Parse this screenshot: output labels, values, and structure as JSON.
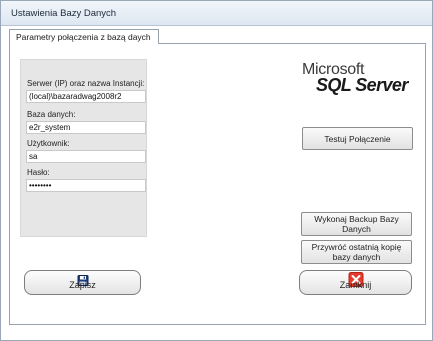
{
  "window": {
    "title": "Ustawienia Bazy Danych"
  },
  "tabs": [
    {
      "label": "Parametry połączenia z bazą daych"
    }
  ],
  "form": {
    "server_label": "Serwer (IP) oraz nazwa Instancji:",
    "server_value": "(local)\\bazaradwag2008r2",
    "database_label": "Baza danych:",
    "database_value": "e2r_system",
    "user_label": "Użytkownik:",
    "user_value": "sa",
    "password_label": "Hasło:",
    "password_value": "••••••••"
  },
  "logo": {
    "line1": "Microsoft",
    "line2": "SQL Server"
  },
  "buttons": {
    "test_connection": "Testuj Połączenie",
    "backup": "Wykonaj Backup Bazy Danych",
    "restore": "Przywróć ostatnią kopię bazy danych",
    "save": "Zapisz",
    "close": "Zamknij"
  },
  "icons": {
    "save": "floppy-disk-icon",
    "close": "red-x-icon"
  },
  "colors": {
    "form_group_bg": "#e6e6e6",
    "close_icon": "#e53b2c"
  }
}
